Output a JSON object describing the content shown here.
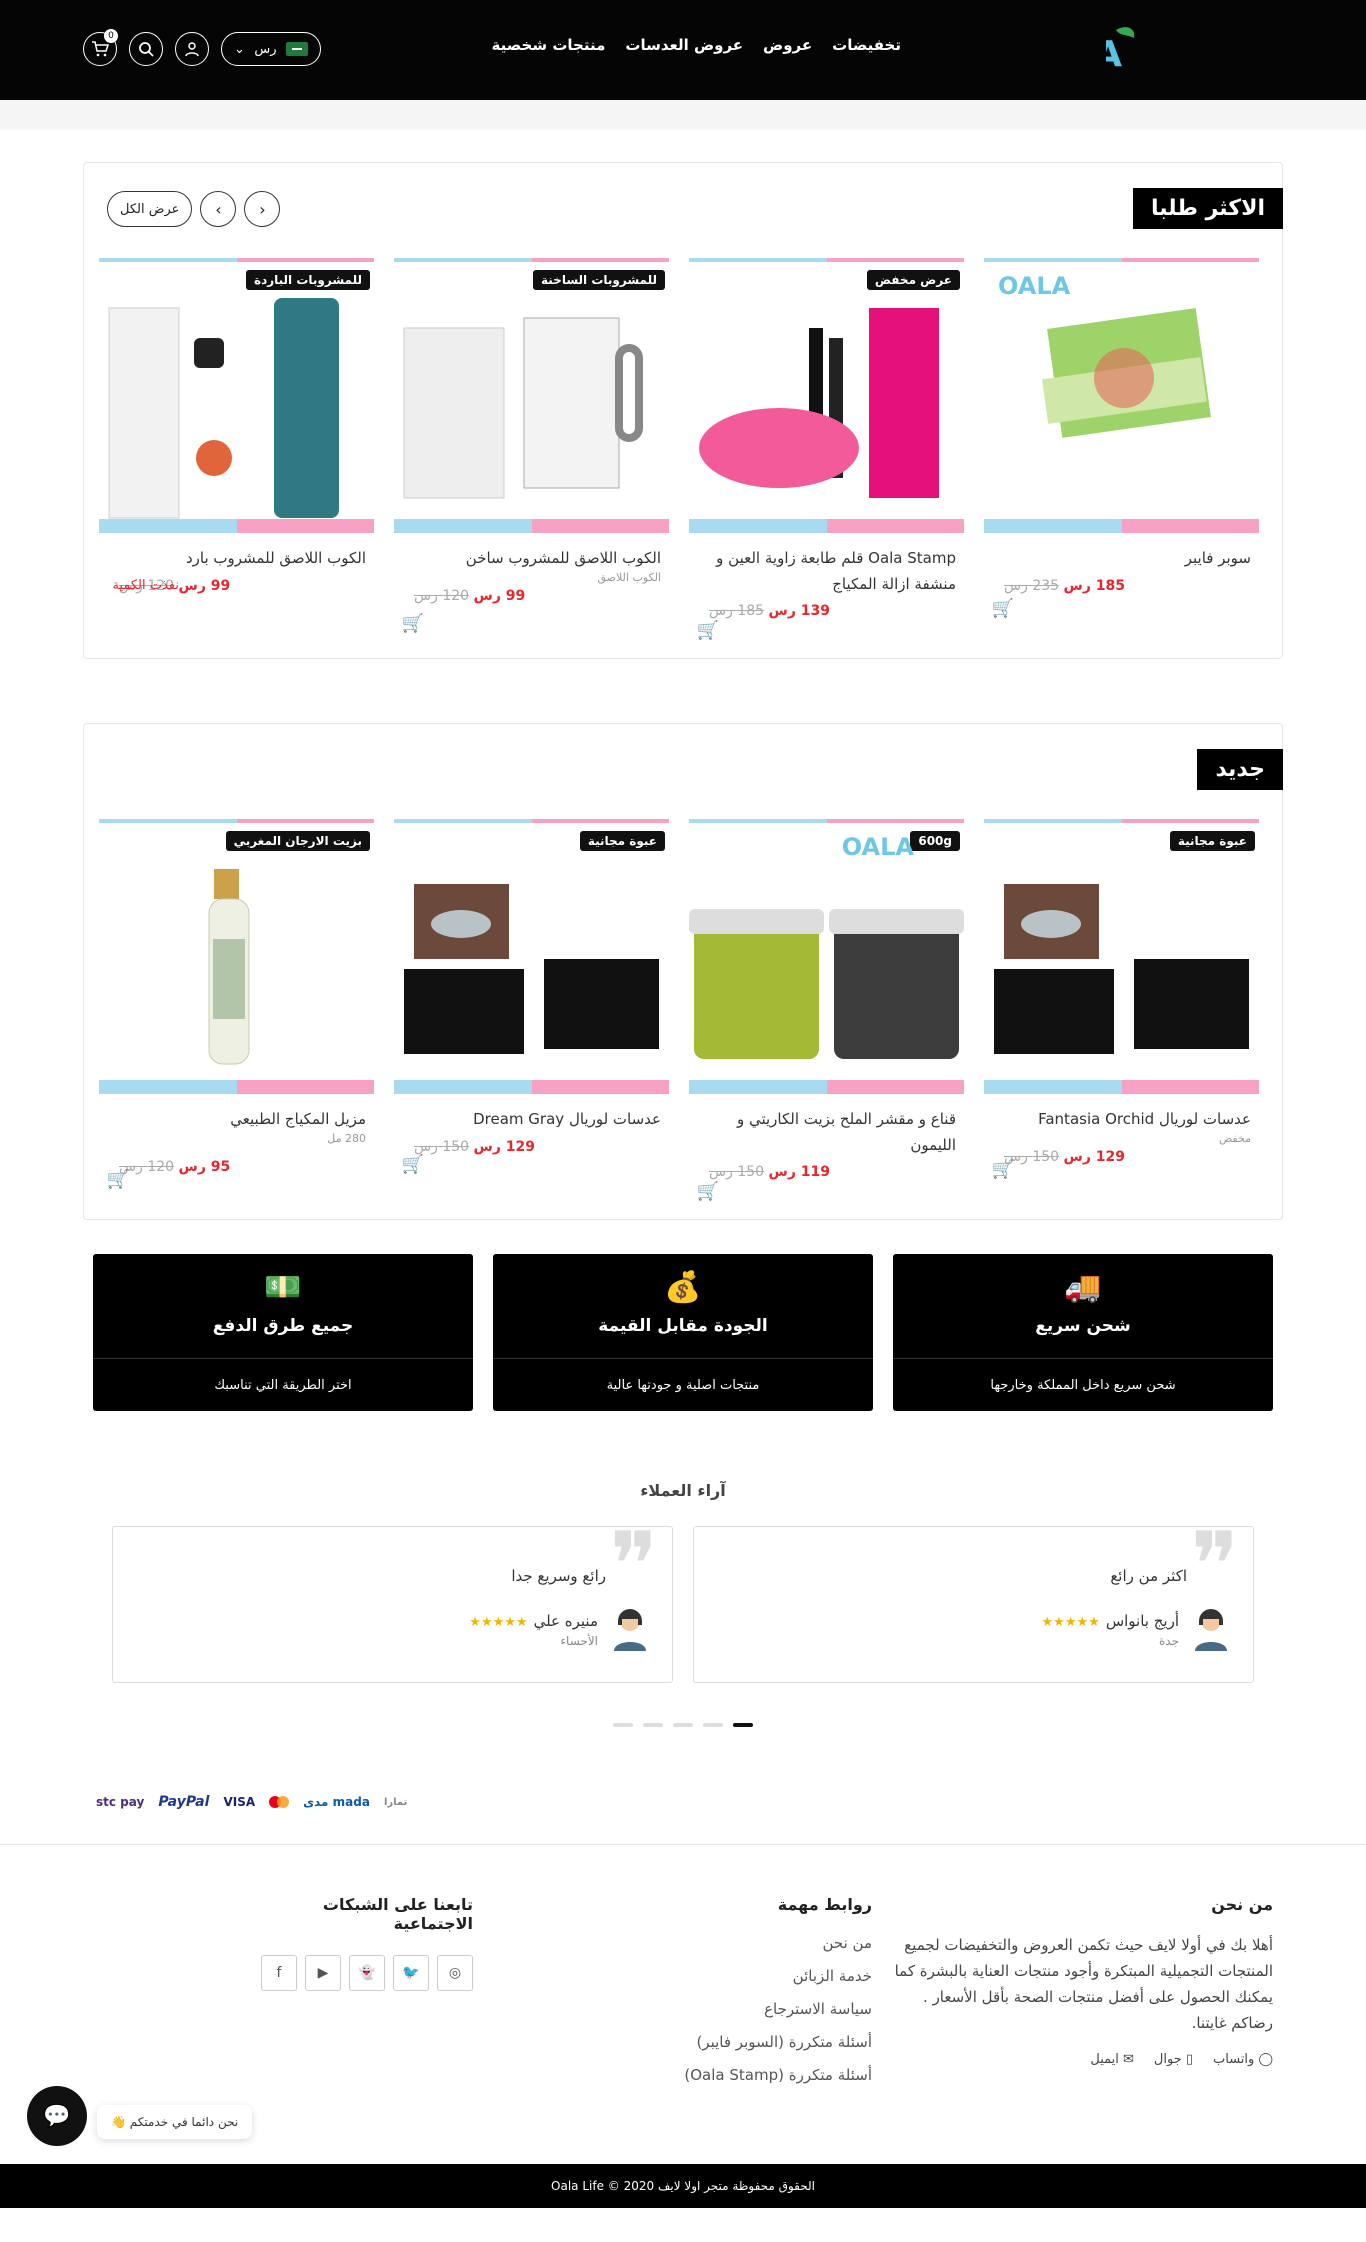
{
  "header": {
    "logo_text": "OALA",
    "nav": [
      "تخفيضات",
      "عروض",
      "عروض العدسات",
      "منتجات شخصية"
    ],
    "currency": "رس",
    "cart_count": "0"
  },
  "best_sellers": {
    "title": "الاكثر طلبا",
    "view_all": "عرض الكل",
    "products": [
      {
        "badge": "",
        "name": "سوبر فايبر",
        "sub": "",
        "old_price": "235 رس",
        "new_price": "185 رس",
        "status": "",
        "watermark": "OALA"
      },
      {
        "badge": "عرض مخفض",
        "name": "Oala Stamp قلم طابعة زاوية العين و منشفة ازالة المكياج",
        "sub": "",
        "old_price": "185 رس",
        "new_price": "139 رس",
        "status": "",
        "watermark": ""
      },
      {
        "badge": "للمشروبات الساخنة",
        "name": "الكوب اللاصق للمشروب ساخن",
        "sub": "الكوب اللاصق",
        "old_price": "120 رس",
        "new_price": "99 رس",
        "status": "",
        "watermark": ""
      },
      {
        "badge": "للمشروبات الباردة",
        "name": "الكوب اللاصق للمشروب بارد",
        "sub": "",
        "old_price": "120 رس",
        "new_price": "99 رس",
        "status": "نفذت الكمية",
        "watermark": ""
      }
    ]
  },
  "new_products": {
    "title": "جديد",
    "products": [
      {
        "badge": "عبوة مجانية",
        "name": "عدسات لوريال Fantasia Orchid",
        "sub": "مخفض",
        "old_price": "150 رس",
        "new_price": "129 رس",
        "status": "",
        "watermark": ""
      },
      {
        "badge": "600g",
        "name": "قناع و مقشر الملح بزيت الكاريتي و الليمون",
        "sub": "",
        "old_price": "150 رس",
        "new_price": "119 رس",
        "status": "",
        "watermark": "OALA"
      },
      {
        "badge": "عبوة مجانية",
        "name": "عدسات لوريال Dream Gray",
        "sub": "",
        "old_price": "150 رس",
        "new_price": "129 رس",
        "status": "",
        "watermark": ""
      },
      {
        "badge": "بزيت الارجان المغربي",
        "name": "مزيل المكياج الطبيعي",
        "sub": "280 مل",
        "old_price": "120 رس",
        "new_price": "95 رس",
        "status": "",
        "watermark": ""
      }
    ]
  },
  "features": [
    {
      "title": "شحن سريع",
      "desc": "شحن سريع داخل المملكة وخارجها",
      "icon": "truck-icon"
    },
    {
      "title": "الجودة مقابل القيمة",
      "desc": "منتجات اصلية و جودتها عالية",
      "icon": "money-bag-icon"
    },
    {
      "title": "جميع طرق الدفع",
      "desc": "اختر الطريقة التي تناسبك",
      "icon": "payment-icon"
    }
  ],
  "reviews": {
    "title": "آراء العملاء",
    "items": [
      {
        "text": "اكثر من رائع",
        "name": "أريج بانواس",
        "city": "جدة",
        "stars": "★★★★★"
      },
      {
        "text": "رائع وسريع جدا",
        "name": "منيره علي",
        "city": "الأحساء",
        "stars": "★★★★★"
      }
    ]
  },
  "payments": {
    "stcpay": "stc pay",
    "paypal": "PayPal",
    "visa": "VISA",
    "mada": "mada",
    "madaar": "مدى",
    "tamara": "تمارا"
  },
  "footer": {
    "about_title": "من نحن",
    "about_text": "أهلا بك في أولا لايف حيث تكمن العروض والتخفيضات لجميع المنتجات التجميلية المبتكرة وأجود منتجات العناية بالبشرة كما يمكنك الحصول على أفضل منتجات الصحة بأقل الأسعار . رضاكم غايتنا.",
    "contact": [
      "واتساب",
      "جوال",
      "ايميل"
    ],
    "links_title": "روابط مهمة",
    "links": [
      "من نحن",
      "خدمة الزبائن",
      "سياسة الاسترجاع",
      "أسئلة متكررة (السوبر فايبر)",
      "أسئلة متكررة (Oala Stamp)"
    ],
    "social_title": "تابعنا على الشبكات الاجتماعية",
    "chat_text": "نحن دائما في خدمتكم",
    "copyright": "الحقوق محفوظة متجر اولا لايف 2020 © Oala Life"
  }
}
